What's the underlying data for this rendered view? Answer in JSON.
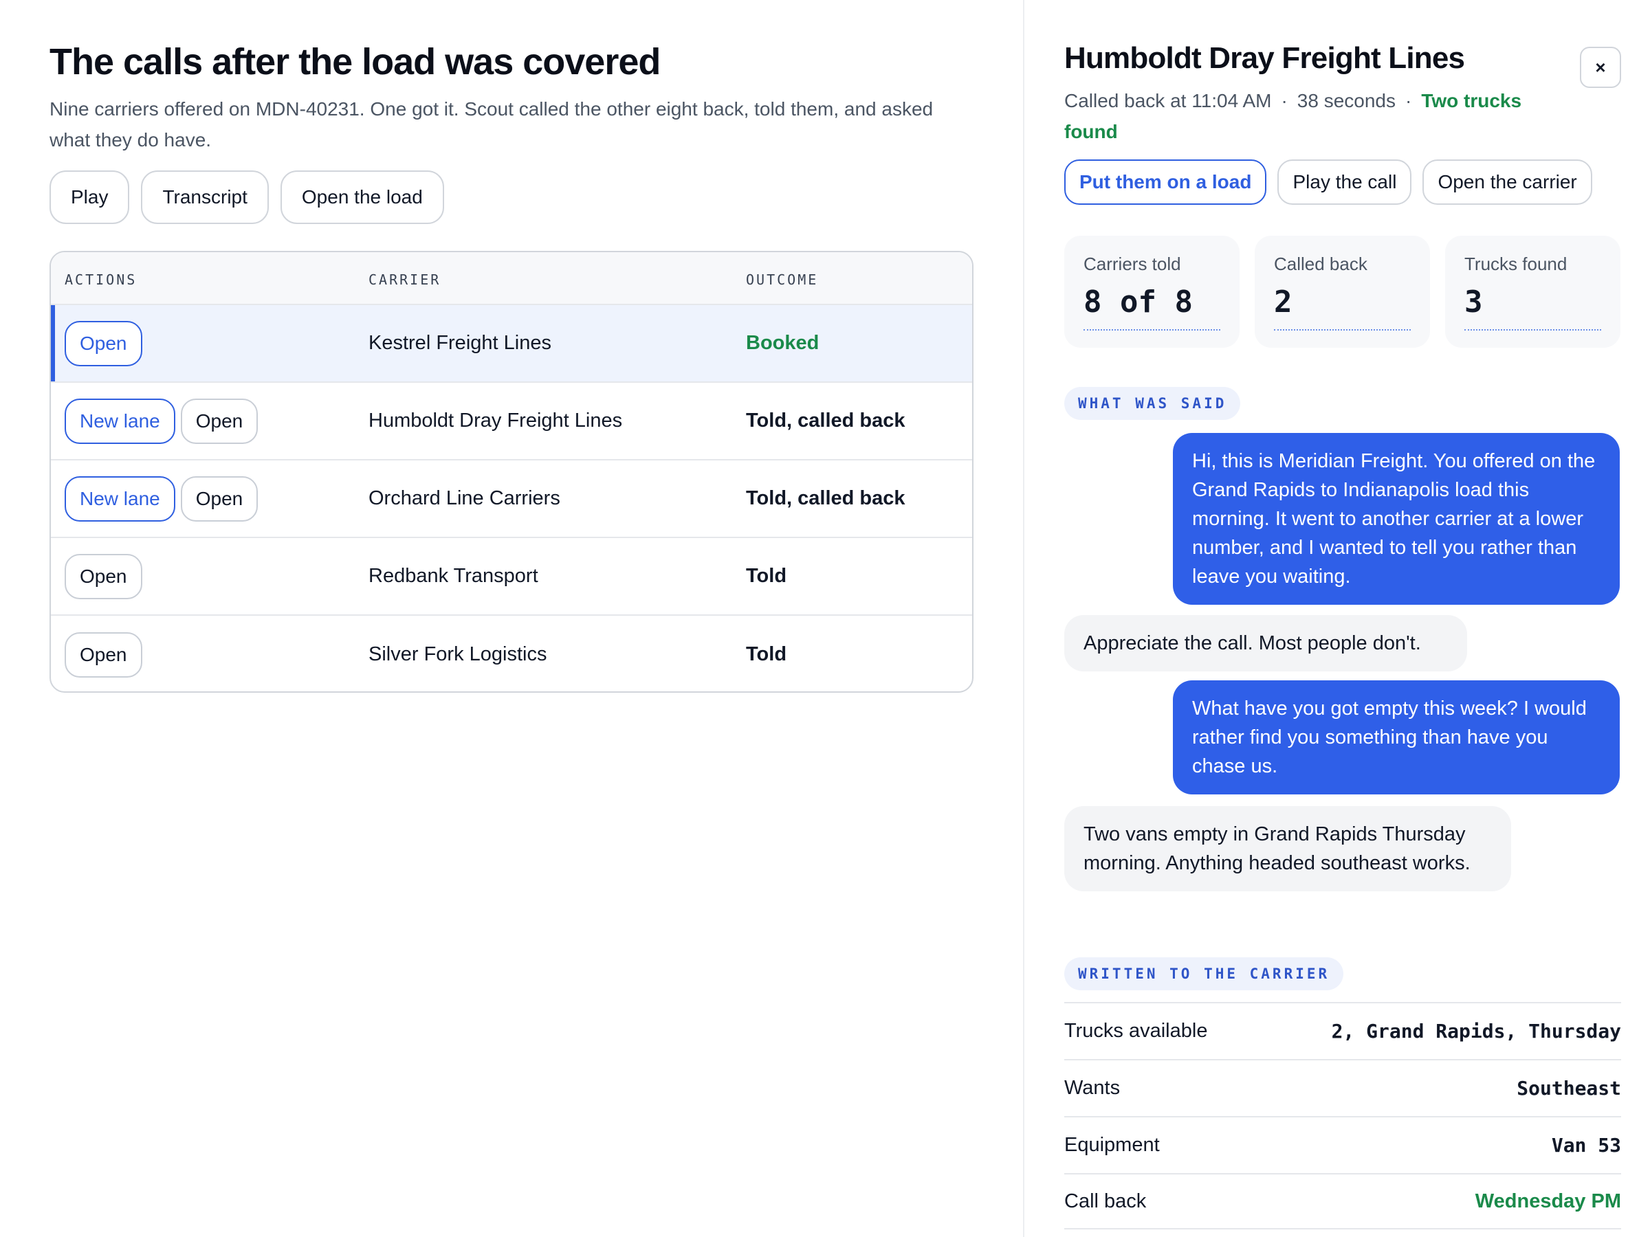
{
  "main": {
    "title": "The calls after the load was covered",
    "subtitle": "Nine carriers offered on MDN-40231. One got it. Scout called the other eight back, told them, and asked what they do have.",
    "buttons": {
      "play": "Play",
      "transcript": "Transcript",
      "open_load": "Open the load"
    },
    "table": {
      "columns": {
        "actions": "ACTIONS",
        "carrier": "CARRIER",
        "outcome": "OUTCOME"
      },
      "rows": [
        {
          "carrier": "Kestrel Freight Lines",
          "outcome": "Booked",
          "action_open": "Open"
        },
        {
          "carrier": "Humboldt Dray Freight Lines",
          "outcome": "Told, called back",
          "action_new_lane": "New lane",
          "action_open": "Open"
        },
        {
          "carrier": "Orchard Line Carriers",
          "outcome": "Told, called back",
          "action_new_lane": "New lane",
          "action_open": "Open"
        },
        {
          "carrier": "Redbank Transport",
          "outcome": "Told",
          "action_open": "Open"
        },
        {
          "carrier": "Silver Fork Logistics",
          "outcome": "Told",
          "action_open": "Open"
        }
      ]
    }
  },
  "panel": {
    "title": "Humboldt Dray Freight Lines",
    "close_label": "×",
    "meta": {
      "called_back": "Called back at 11:04 AM",
      "duration": "38 seconds",
      "separator": "·",
      "result": "Two trucks found"
    },
    "buttons": {
      "put_on_load": "Put them on a load",
      "play_call": "Play the call",
      "open_carrier": "Open the carrier"
    },
    "stats": [
      {
        "label": "Carriers told",
        "value": "8 of 8"
      },
      {
        "label": "Called back",
        "value": "2"
      },
      {
        "label": "Trucks found",
        "value": "3"
      }
    ],
    "said_heading": "WHAT WAS SAID",
    "messages": [
      {
        "from": "scout",
        "text": "Hi, this is Meridian Freight. You offered on the Grand Rapids to Indianapolis load this morning. It went to another carrier at a lower number, and I wanted to tell you rather than leave you waiting."
      },
      {
        "from": "carrier",
        "text": "Appreciate the call. Most people don't."
      },
      {
        "from": "scout",
        "text": "What have you got empty this week? I would rather find you something than have you chase us."
      },
      {
        "from": "carrier",
        "text": "Two vans empty in Grand Rapids Thursday morning. Anything headed southeast works."
      }
    ],
    "written_heading": "WRITTEN TO THE CARRIER",
    "fields": [
      {
        "key": "Trucks available",
        "value": "2, Grand Rapids, Thursday"
      },
      {
        "key": "Wants",
        "value": "Southeast"
      },
      {
        "key": "Equipment",
        "value": "Van 53"
      },
      {
        "key": "Call back",
        "value": "Wednesday PM"
      }
    ]
  },
  "colors": {
    "accent": "#2f5fe0",
    "success": "#1a8a4a",
    "bubble_out": "#2f5fe8",
    "bubble_in": "#f3f4f6"
  }
}
